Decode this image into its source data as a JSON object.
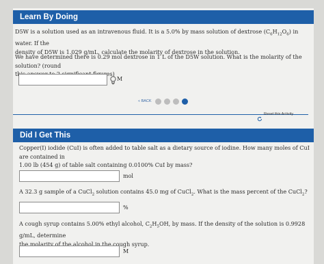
{
  "learn": {
    "title": "Learn By Doing",
    "p1_line1": "D5W is a solution used as an intravenous fluid. It is a 5.0% by mass solution of dextrose (C",
    "p1_line1_sub1": "6",
    "p1_line1_mid": "H",
    "p1_line1_sub2": "12",
    "p1_line1_mid2": "O",
    "p1_line1_sub3": "6",
    "p1_line1_end": ") in water. If the",
    "p1_line2": "density of D5W is 1.029 g/mL, calculate the molarity of dextrose in the solution.",
    "p2_line1": "We have determined there is 0.29 mol dextrose in 1 L of the D5W solution. What is the molarity of the solution? (round",
    "p2_line2": "this answer to 2 significant figures)",
    "answer_value": "",
    "answer_unit": "M",
    "back_label": "« BACK",
    "reset_label": "Reset this Activity",
    "progress_colors": [
      "#bdbdbd",
      "#bdbdbd",
      "#bdbdbd",
      "#1e5fa8"
    ]
  },
  "didi": {
    "title": "Did I Get This",
    "q1_line1": "Copper(I) iodide (CuI) is often added to table salt as a dietary source of iodine. How many moles of CuI are contained in",
    "q1_line2": "1.00 lb (454 g) of table salt containing 0.0100% CuI by mass?",
    "q1_unit": "mol",
    "q2_a": "A 32.3 g sample of a CuCl",
    "q2_sub1": "2",
    "q2_b": " solution contains 45.0 mg of CuCl",
    "q2_sub2": "2",
    "q2_c": ". What is the mass percent of the CuCl",
    "q2_sub3": "2",
    "q2_d": "?",
    "q2_unit": "%",
    "q3_a": "A cough syrup contains 5.00% ethyl alcohol, C",
    "q3_sub1": "2",
    "q3_b": "H",
    "q3_sub2": "5",
    "q3_c": "OH, by mass. If the density of the solution is 0.9928 g/mL, determine",
    "q3_line2": "the molarity of the alcohol in the cough syrup.",
    "q3_unit": "M"
  },
  "colors": {
    "accent": "#1e5fa8",
    "background": "#d9d9d6",
    "card": "#f1f1ef"
  }
}
